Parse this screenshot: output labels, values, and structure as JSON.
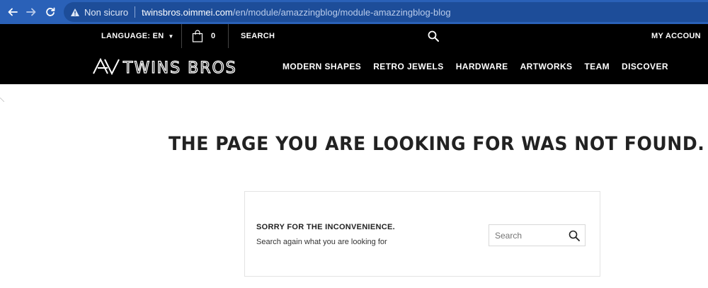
{
  "browser": {
    "insecure_label": "Non sicuro",
    "url_host": "twinsbros.oimmei.com",
    "url_path": "/en/module/amazzingblog/module-amazzingblog-blog"
  },
  "topbar": {
    "language_label": "LANGUAGE: EN",
    "cart_count": "0",
    "search_label": "SEARCH",
    "account_label": "MY ACCOUNT"
  },
  "nav": {
    "logo_text": "TWINS BROS",
    "items": [
      "MODERN SHAPES",
      "RETRO JEWELS",
      "HARDWARE",
      "ARTWORKS",
      "TEAM",
      "DISCOVER"
    ]
  },
  "content": {
    "headline": "THE PAGE YOU ARE LOOKING FOR WAS NOT FOUND.",
    "sorry_title": "SORRY FOR THE INCONVENIENCE.",
    "sorry_sub": "Search again what you are looking for",
    "search_placeholder": "Search"
  },
  "colors": {
    "browser_bar": "#2a61b8",
    "header_bg": "#000000",
    "headline": "#222222"
  }
}
